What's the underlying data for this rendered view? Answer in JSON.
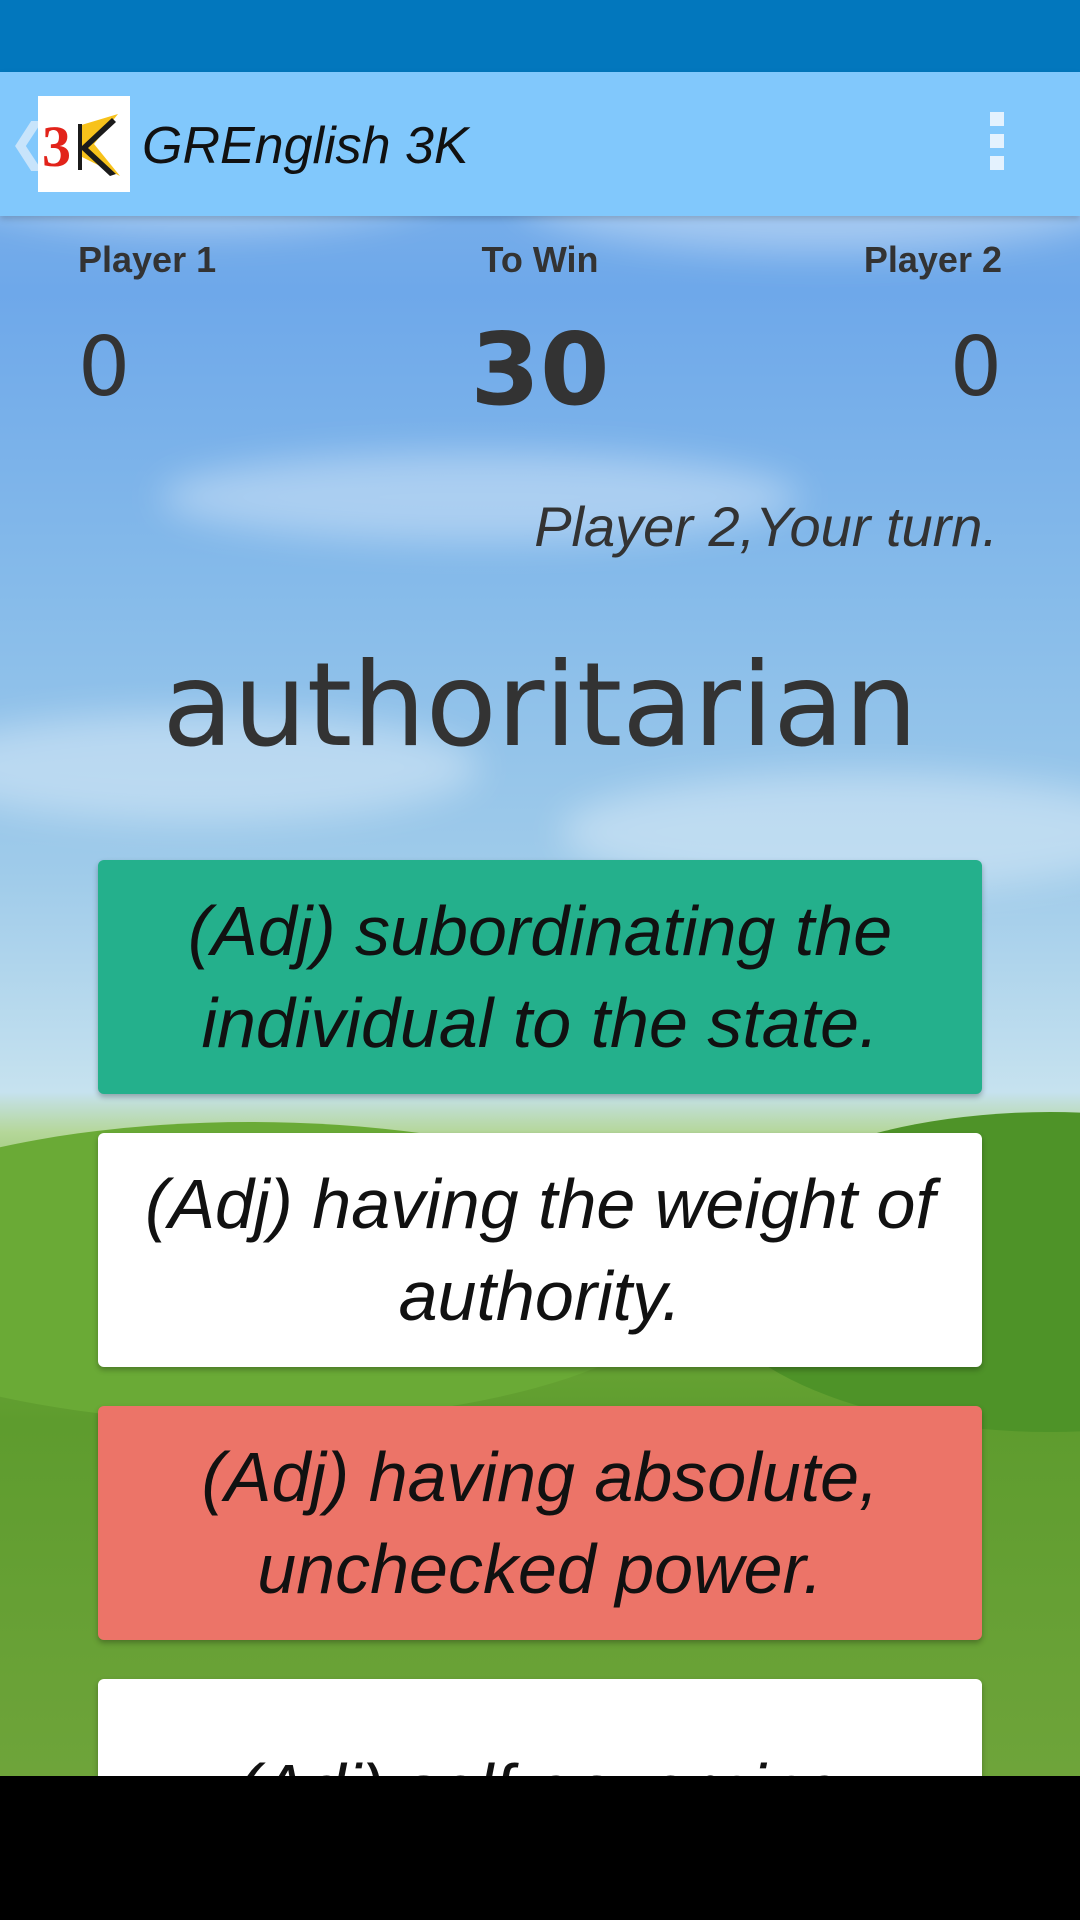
{
  "app_bar": {
    "title": "GREnglish 3K",
    "back_icon": "chevron-left-icon",
    "logo_icon": "3k-logo-icon",
    "logo_text": "3K",
    "menu_icon": "overflow-menu-icon"
  },
  "scoreboard": {
    "player1_label": "Player 1",
    "player1_score": "0",
    "to_win_label": "To Win",
    "to_win_value": "30",
    "player2_label": "Player 2",
    "player2_score": "0"
  },
  "turn_message": "Player 2,Your turn.",
  "word": "authoritarian",
  "options": [
    {
      "text": "(Adj) subordinating the individual to the state.",
      "state": "correct"
    },
    {
      "text": "(Adj) having the weight of authority.",
      "state": "neutral"
    },
    {
      "text": "(Adj) having absolute, unchecked power.",
      "state": "wrong"
    },
    {
      "text": "(Adj) self-governing",
      "state": "neutral"
    }
  ],
  "colors": {
    "status_bar": "#0277bd",
    "app_bar": "#81c8fc",
    "correct": "#24b08c",
    "wrong": "#ec7468",
    "neutral": "#ffffff"
  }
}
